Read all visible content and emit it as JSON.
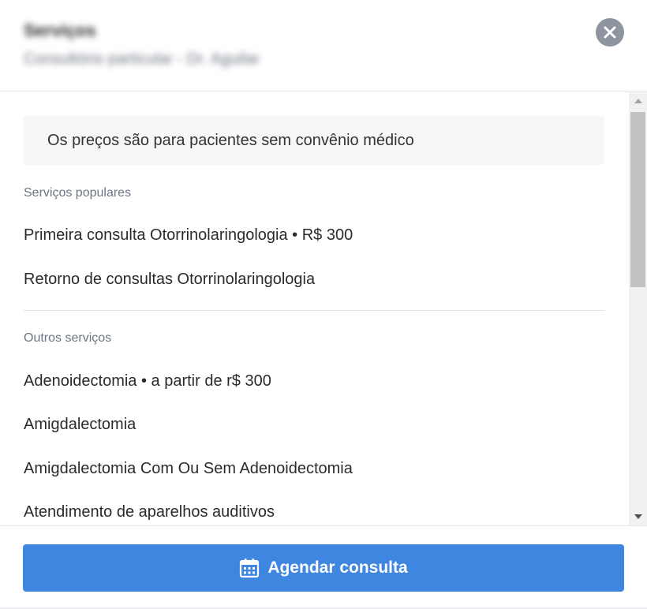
{
  "header": {
    "title": "Serviços",
    "subtitle": "Consultório particular - Dr. Aguilar"
  },
  "notice": "Os preços são para pacientes sem convênio médico",
  "popular": {
    "label": "Serviços populares",
    "items": [
      "Primeira consulta Otorrinolaringologia • R$ 300",
      "Retorno de consultas Otorrinolaringologia"
    ]
  },
  "other": {
    "label": "Outros serviços",
    "items": [
      "Adenoidectomia • a partir de r$ 300",
      "Amigdalectomia",
      "Amigdalectomia Com Ou Sem Adenoidectomia",
      "Atendimento de aparelhos auditivos"
    ]
  },
  "footer": {
    "button_label": "Agendar consulta",
    "button_icon": "calendar-icon"
  },
  "colors": {
    "accent": "#3f86e0",
    "close_button": "#8e959f",
    "notice_bg": "#f5f7f9"
  }
}
